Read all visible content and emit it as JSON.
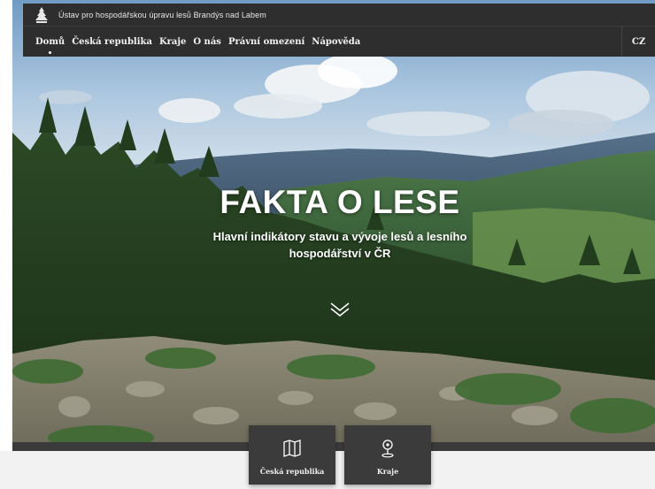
{
  "header": {
    "org_name": "Ústav pro hospodářskou úpravu lesů Brandýs nad Labem",
    "logo_icon": "tree-logo-icon"
  },
  "nav": {
    "items": [
      {
        "label": "Domů",
        "active": true
      },
      {
        "label": "Česká republika",
        "active": false
      },
      {
        "label": "Kraje",
        "active": false
      },
      {
        "label": "O nás",
        "active": false
      },
      {
        "label": "Právní omezení",
        "active": false
      },
      {
        "label": "Nápověda",
        "active": false
      }
    ],
    "language": "CZ"
  },
  "hero": {
    "title": "FAKTA O LESE",
    "subtitle": "Hlavní indikátory stavu a vývoje lesů a lesního hospodářství v ČR",
    "scroll_icon": "double-chevron-down-icon"
  },
  "tiles": [
    {
      "label": "Česká republika",
      "icon": "map-icon"
    },
    {
      "label": "Kraje",
      "icon": "map-pin-icon"
    }
  ],
  "colors": {
    "header_bg": "#2e2e2e",
    "tile_bg": "#3b3b3b",
    "text_light": "#ffffff"
  }
}
